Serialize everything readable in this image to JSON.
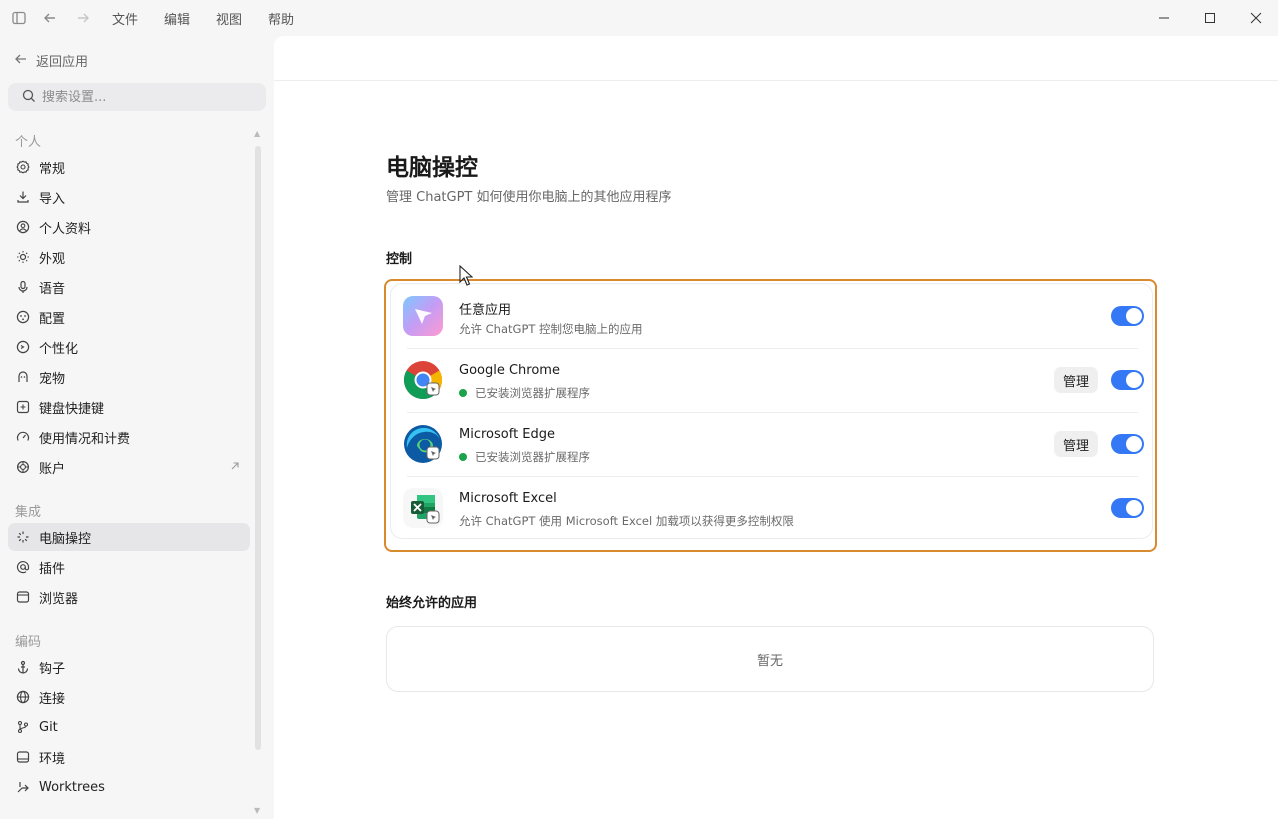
{
  "menu": {
    "file": "文件",
    "edit": "编辑",
    "view": "视图",
    "help": "帮助"
  },
  "sidebar": {
    "back_label": "返回应用",
    "search_placeholder": "搜索设置...",
    "sections": [
      {
        "label": "个人",
        "items": [
          {
            "label": "常规",
            "icon": "gear-icon"
          },
          {
            "label": "导入",
            "icon": "download-icon"
          },
          {
            "label": "个人资料",
            "icon": "user-circle-icon"
          },
          {
            "label": "外观",
            "icon": "sun-icon"
          },
          {
            "label": "语音",
            "icon": "microphone-icon"
          },
          {
            "label": "配置",
            "icon": "config-icon"
          },
          {
            "label": "个性化",
            "icon": "personalize-icon"
          },
          {
            "label": "宠物",
            "icon": "pet-icon"
          },
          {
            "label": "键盘快捷键",
            "icon": "keyboard-icon"
          },
          {
            "label": "使用情况和计费",
            "icon": "gauge-icon"
          },
          {
            "label": "账户",
            "icon": "openai-icon"
          }
        ]
      },
      {
        "label": "集成",
        "items": [
          {
            "label": "电脑操控",
            "icon": "sparkle-icon",
            "active": true
          },
          {
            "label": "插件",
            "icon": "at-icon"
          },
          {
            "label": "浏览器",
            "icon": "browser-icon"
          }
        ]
      },
      {
        "label": "编码",
        "items": [
          {
            "label": "钩子",
            "icon": "anchor-icon"
          },
          {
            "label": "连接",
            "icon": "globe-icon"
          },
          {
            "label": "Git",
            "icon": "git-branch-icon"
          },
          {
            "label": "环境",
            "icon": "monitor-icon"
          },
          {
            "label": "Worktrees",
            "icon": "worktree-icon"
          }
        ]
      }
    ]
  },
  "main": {
    "title": "电脑操控",
    "subtitle": "管理 ChatGPT 如何使用你电脑上的其他应用程序",
    "controls_label": "控制",
    "apps": [
      {
        "name": "任意应用",
        "desc": "允许 ChatGPT 控制您电脑上的应用",
        "enabled": true,
        "icon": "any-app-icon"
      },
      {
        "name": "Google Chrome",
        "desc": "已安装浏览器扩展程序",
        "status": "installed",
        "manage": "管理",
        "enabled": true,
        "icon": "chrome-icon"
      },
      {
        "name": "Microsoft Edge",
        "desc": "已安装浏览器扩展程序",
        "status": "installed",
        "manage": "管理",
        "enabled": true,
        "icon": "edge-icon"
      },
      {
        "name": "Microsoft Excel",
        "desc": "允许 ChatGPT 使用 Microsoft Excel 加载项以获得更多控制权限",
        "enabled": true,
        "icon": "excel-icon"
      }
    ],
    "always_allowed_label": "始终允许的应用",
    "always_allowed_empty": "暂无"
  },
  "colors": {
    "accent": "#3478f6",
    "highlight": "#d88a2e",
    "status_green": "#19a34a"
  }
}
